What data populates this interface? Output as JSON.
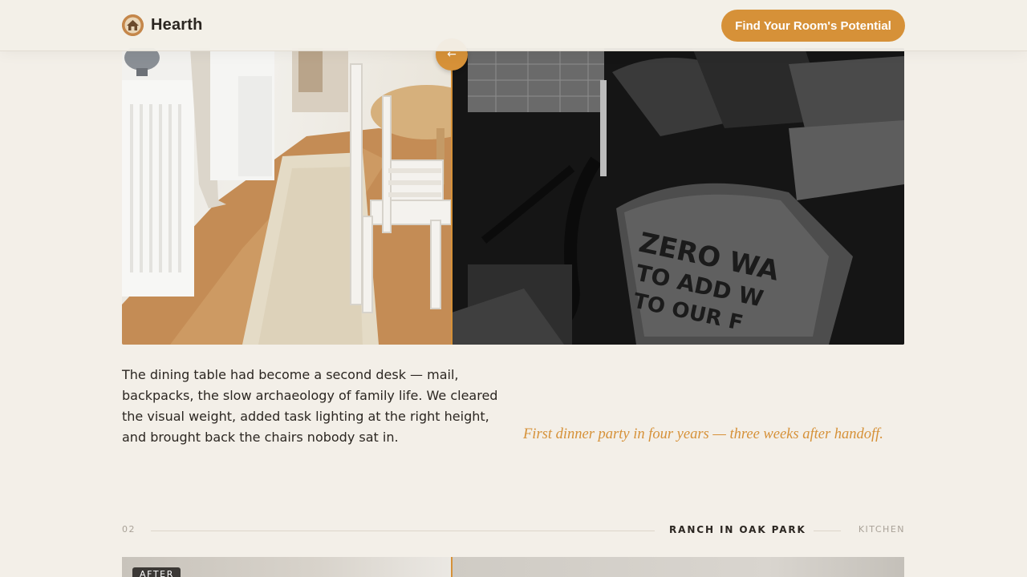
{
  "brand": {
    "name": "Hearth",
    "logo_icon": "house-logo-icon"
  },
  "header": {
    "cta_label": "Find Your Room's Potential"
  },
  "project_1": {
    "handle_icon": "arrow-left-icon",
    "handle_glyph": "←",
    "before_text": "ZERO WA TO ADD W TO OUR F",
    "story": "The dining table had become a second desk — mail, backpacks, the slow archaeology of family life. We cleared the visual weight, added task lighting at the right height, and brought back the chairs nobody sat in.",
    "quote": "First dinner party in four years — three weeks after handoff."
  },
  "project_2": {
    "number": "02",
    "title": "RANCH IN OAK PARK",
    "category": "KITCHEN",
    "after_badge": "AFTER"
  },
  "colors": {
    "accent": "#d69138",
    "background": "#f3efe8",
    "text": "#2b2621"
  }
}
